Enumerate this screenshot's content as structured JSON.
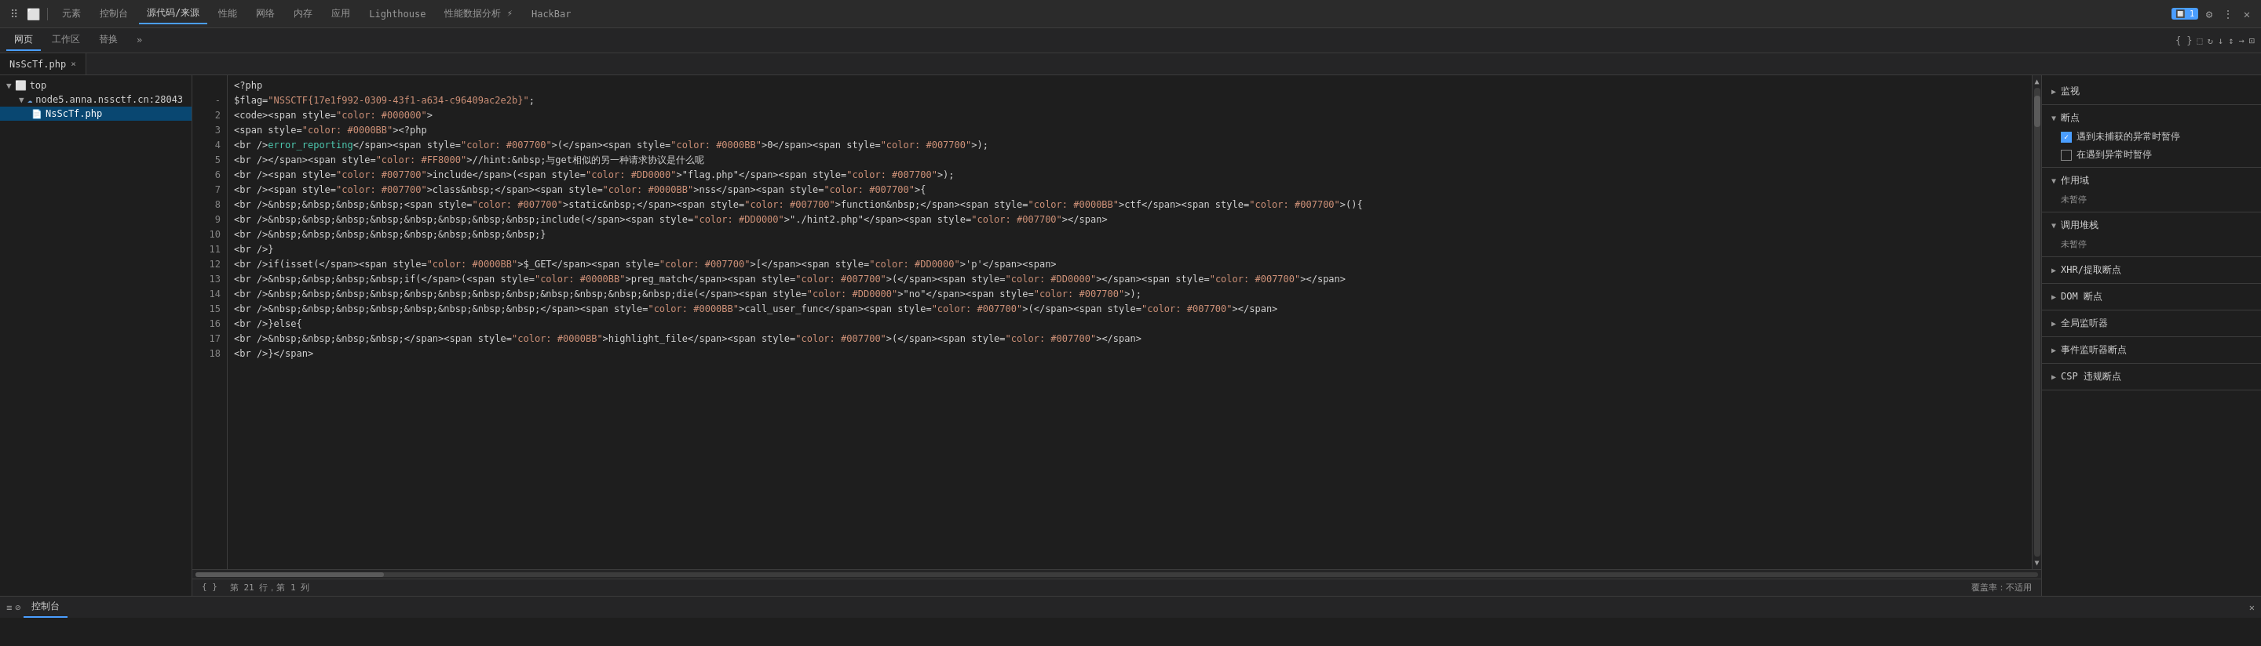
{
  "toolbar": {
    "icons": [
      "☰",
      "⬜"
    ],
    "tabs": [
      "元素",
      "控制台",
      "源代码/来源",
      "性能",
      "网络",
      "内存",
      "应用",
      "Lighthouse",
      "性能数据分析 ⚡",
      "HackBar"
    ],
    "active_tab": "源代码/来源",
    "right_icons": [
      "🔲",
      "⚙",
      "⋮",
      "✕"
    ]
  },
  "secondary_toolbar": {
    "tabs": [
      "网页",
      "工作区",
      "替换",
      "»"
    ],
    "active_tab": "网页",
    "icons": [
      "⬚",
      "≡",
      "↻",
      "↓",
      "↕",
      "→",
      "⊡"
    ]
  },
  "file_tab": {
    "name": "NsScTf.php",
    "close": "×"
  },
  "sidebar": {
    "items": [
      {
        "label": "top",
        "type": "folder",
        "expanded": true,
        "indent": 0
      },
      {
        "label": "node5.anna.nssctf.cn:28043",
        "type": "cloud",
        "expanded": true,
        "indent": 1
      },
      {
        "label": "NsScTf.php",
        "type": "file",
        "indent": 2,
        "selected": true
      }
    ]
  },
  "code": {
    "lines": [
      {
        "num": "",
        "content": "<?php"
      },
      {
        "num": "-",
        "content": "$flag=\"NSSCTF{17e1f992-0309-43f1-a634-c96409ac2e2b}\";"
      },
      {
        "num": "2",
        "content": "<code><span style=\"color: #000000\">"
      },
      {
        "num": "3",
        "content": "<span style=\"color: #0000BB\">&lt;?php"
      },
      {
        "num": "4",
        "content": "<br /><span style=\"color: #007700\">error_reporting</span>(<span style=\"color: #007700\"></span><span style=\"color: #0000BB\">0</span><span style=\"color: #007700\">);"
      },
      {
        "num": "5",
        "content": "<br /></span><span style=\"color: #FF8000\">//hint:&nbsp;与get相似的另一种请求协议是什么呢"
      },
      {
        "num": "6",
        "content": "<br /><span style=\"color: #007700\">include</span>(<span style=\"color: #DD0000\">\"flag.php\"</span>)<span style=\"color: #007700\">);"
      },
      {
        "num": "7",
        "content": "<br /><span style=\"color: #007700\">class&nbsp;</span><span style=\"color: #0000BB\">nss</span><span style=\"color: #007700\">{"
      },
      {
        "num": "8",
        "content": "<br />&nbsp;&nbsp;&nbsp;&nbsp;<span style=\"color: #007700\">static&nbsp;</span><span style=\"color: #007700\">function&nbsp;</span><span style=\"color: #0000BB\">ctf</span><span style=\"color: #007700\">(){"
      },
      {
        "num": "9",
        "content": "<br />&nbsp;&nbsp;&nbsp;&nbsp;&nbsp;&nbsp;&nbsp;&nbsp;include(<span style=\"color: #DD0000\">\"./hint2.php\"</span><span style=\"color: #007700\"></span>"
      },
      {
        "num": "10",
        "content": "<br />&nbsp;&nbsp;&nbsp;&nbsp;&nbsp;&nbsp;&nbsp;&nbsp;}"
      },
      {
        "num": "11",
        "content": "<br />}"
      },
      {
        "num": "12",
        "content": "<br />if(isset(<span style=\"color: #0000BB\">$_GET</span><span style=\"color: #007700\">[</span><span style=\"color: #DD0000\">'p'</span><span>"
      },
      {
        "num": "13",
        "content": "<br />&nbsp;&nbsp;&nbsp;&nbsp;if(<span style=\"color: #007700\"></span>(<span style=\"color: #0000BB\">preg_match</span><span style=\"color: #007700\">(</span><span style=\"color: #DD0000\"></span><span style=\"color: #007700\"></span>"
      },
      {
        "num": "14",
        "content": "<br />&nbsp;&nbsp;&nbsp;&nbsp;&nbsp;&nbsp;&nbsp;&nbsp;&nbsp;&nbsp;&nbsp;&nbsp;die(<span style=\"color: #DD0000\">\"no\"</span><span style=\"color: #007700\">);"
      },
      {
        "num": "15",
        "content": "<br />&nbsp;&nbsp;&nbsp;&nbsp;&nbsp;&nbsp;&nbsp;&nbsp;</span><span style=\"color: #0000BB\">call_user_func</span><span style=\"color: #007700\">(</span><span style=\"color: #007700\"></span>"
      },
      {
        "num": "16",
        "content": "<br />}else{"
      },
      {
        "num": "17",
        "content": "<br />&nbsp;&nbsp;&nbsp;&nbsp;</span><span style=\"color: #0000BB\">highlight_file</span><span style=\"color: #007700\">(</span><span style=\"color: #007700\"></span>"
      },
      {
        "num": "18",
        "content": "<br />}</span>"
      }
    ]
  },
  "status": {
    "line_col": "第 21 行，第 1 列",
    "coverage": "覆盖率：不适用"
  },
  "right_panel": {
    "sections": [
      {
        "title": "监视",
        "collapsed": false,
        "arrow": "▶"
      },
      {
        "title": "断点",
        "collapsed": false,
        "arrow": "▼",
        "items": [
          {
            "label": "遇到未捕获的异常时暂停",
            "checked": true
          },
          {
            "label": "在遇到异常时暂停",
            "checked": false
          }
        ]
      },
      {
        "title": "作用域",
        "collapsed": false,
        "arrow": "▼",
        "empty_label": "未暂停"
      },
      {
        "title": "调用堆栈",
        "collapsed": false,
        "arrow": "▼",
        "empty_label": "未暂停"
      },
      {
        "title": "XHR/提取断点",
        "collapsed": false,
        "arrow": "▶"
      },
      {
        "title": "DOM 断点",
        "collapsed": false,
        "arrow": "▶"
      },
      {
        "title": "全局监听器",
        "collapsed": false,
        "arrow": "▶"
      },
      {
        "title": "事件监听器断点",
        "collapsed": false,
        "arrow": "▶"
      },
      {
        "title": "CSP 违规断点",
        "collapsed": false,
        "arrow": "▶"
      }
    ]
  },
  "console_bar": {
    "left_icons": [
      "≡",
      "⊘"
    ],
    "tab_label": "控制台",
    "right_icon": "✕"
  }
}
